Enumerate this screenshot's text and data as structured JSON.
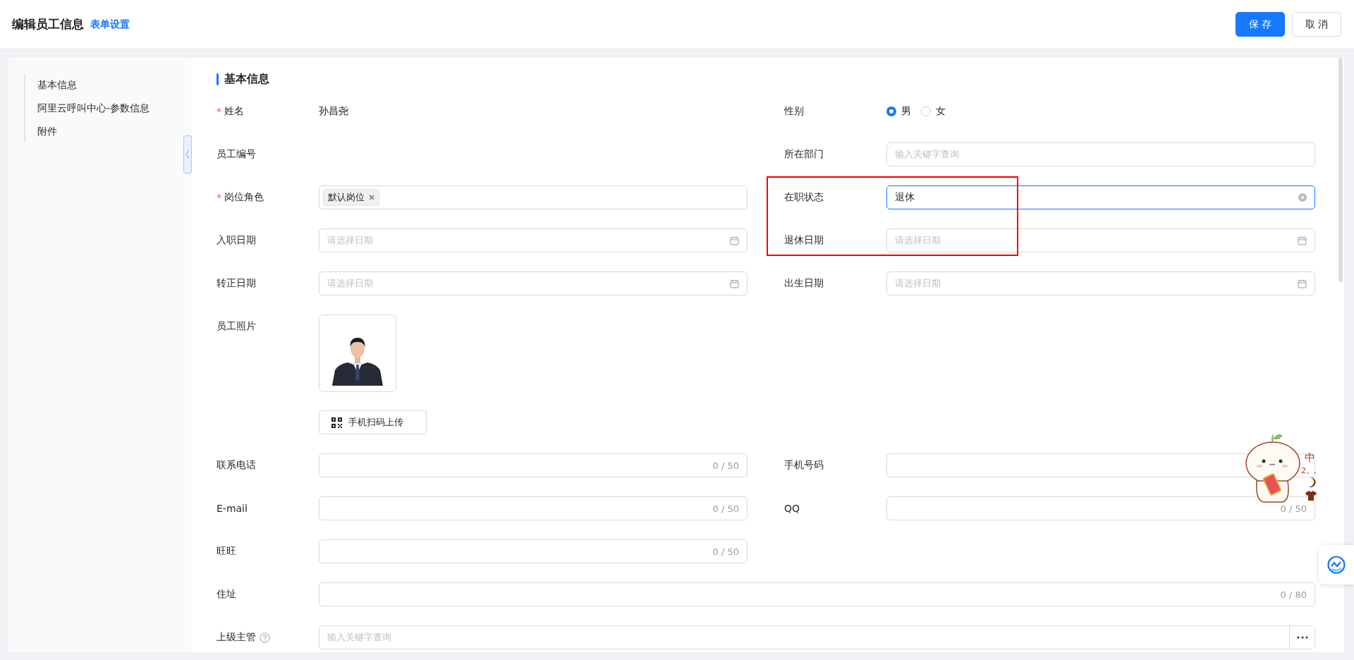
{
  "header": {
    "title": "编辑员工信息",
    "link": "表单设置",
    "buttons": [
      {
        "label": "保 存",
        "kind": "primary"
      },
      {
        "label": "取 消",
        "kind": "default"
      }
    ]
  },
  "sidebar": {
    "items": [
      {
        "label": "基本信息"
      },
      {
        "label": "阿里云呼叫中心-参数信息"
      },
      {
        "label": "附件"
      }
    ]
  },
  "section": {
    "title": "基本信息"
  },
  "fields": [
    {
      "label": "姓名",
      "required_mark": "*",
      "kind": "text",
      "value": "孙昌尧"
    },
    {
      "label": "性别",
      "kind": "radio",
      "options": [
        {
          "label": "男",
          "selected": true
        },
        {
          "label": "女",
          "selected": false
        }
      ]
    },
    {
      "label": "员工编号",
      "kind": "text"
    },
    {
      "label": "所在部门",
      "kind": "input",
      "placeholder": "输入关键字查询"
    },
    {
      "label": "岗位角色",
      "required_mark": "*",
      "kind": "tags",
      "tags": [
        "默认岗位"
      ]
    },
    {
      "label": "在职状态",
      "kind": "input",
      "value": "退休",
      "focused": true,
      "clearable": true
    },
    {
      "label": "入职日期",
      "kind": "date",
      "placeholder": "请选择日期"
    },
    {
      "label": "退休日期",
      "kind": "date",
      "placeholder": "请选择日期"
    },
    {
      "label": "转正日期",
      "kind": "date",
      "placeholder": "请选择日期"
    },
    {
      "label": "出生日期",
      "kind": "date",
      "placeholder": "请选择日期"
    },
    {
      "label": "员工照片",
      "button": "手机扫码上传"
    },
    {
      "kind": "blank"
    },
    {
      "label": "联系电话",
      "kind": "input",
      "counter": "0 / 50"
    },
    {
      "label": "手机号码",
      "kind": "input"
    },
    {
      "label": "E-mail",
      "kind": "input",
      "counter": "0 / 50"
    },
    {
      "label": "QQ",
      "kind": "input",
      "counter": "0 / 50"
    },
    {
      "label": "旺旺",
      "kind": "input",
      "counter": "0 / 50"
    },
    {
      "kind": "blank"
    },
    {
      "label": "住址",
      "kind": "input",
      "counter": "0 / 80",
      "full_width": true
    },
    {
      "label": "上级主管",
      "kind": "picker",
      "placeholder": "输入关键字查询",
      "help": true,
      "full_width": true
    }
  ],
  "ime": {
    "mode": "中",
    "punct": "2。,"
  }
}
